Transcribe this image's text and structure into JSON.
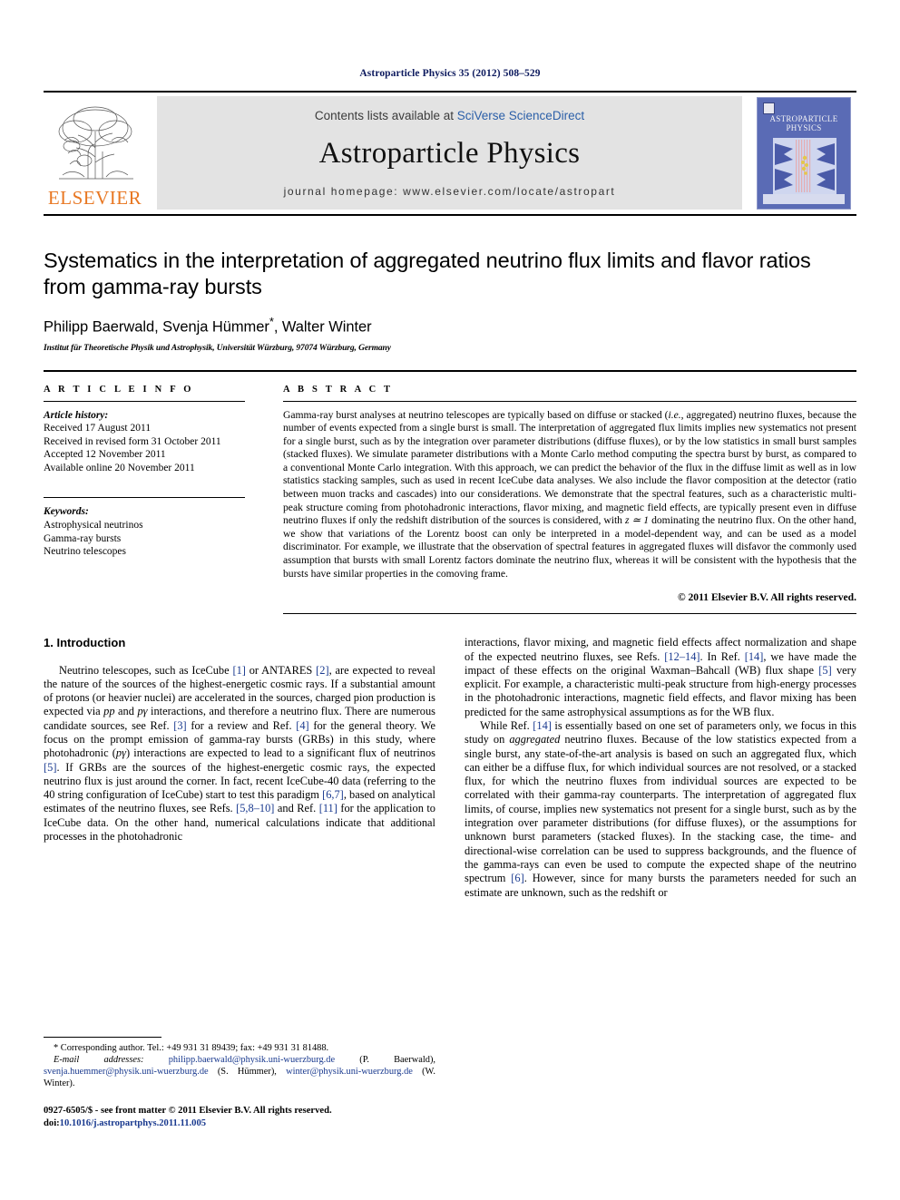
{
  "running_head": "Astroparticle Physics 35 (2012) 508–529",
  "masthead": {
    "contents_prefix": "Contents lists available at ",
    "contents_link": "SciVerse ScienceDirect",
    "journal_title": "Astroparticle Physics",
    "homepage": "journal homepage: www.elsevier.com/locate/astropart",
    "publisher_wordmark": "ELSEVIER",
    "cover_title_line1": "ASTROPARTICLE",
    "cover_title_line2": "PHYSICS"
  },
  "article": {
    "title": "Systematics in the interpretation of aggregated neutrino flux limits and flavor ratios from gamma-ray bursts",
    "authors": "Philipp Baerwald, Svenja Hümmer",
    "authors_suffix": ", Walter Winter",
    "corresponding_marker": "*",
    "affiliation": "Institut für Theoretische Physik und Astrophysik, Universität Würzburg, 97074 Würzburg, Germany"
  },
  "article_info": {
    "heading": "A R T I C L E   I N F O",
    "history_label": "Article history:",
    "history": [
      "Received 17 August 2011",
      "Received in revised form 31 October 2011",
      "Accepted 12 November 2011",
      "Available online 20 November 2011"
    ],
    "keywords_label": "Keywords:",
    "keywords": [
      "Astrophysical neutrinos",
      "Gamma-ray bursts",
      "Neutrino telescopes"
    ]
  },
  "abstract": {
    "heading": "A B S T R A C T",
    "part1": "Gamma-ray burst analyses at neutrino telescopes are typically based on diffuse or stacked (",
    "italic1": "i.e.",
    "part2": ", aggregated) neutrino fluxes, because the number of events expected from a single burst is small. The interpretation of aggregated flux limits implies new systematics not present for a single burst, such as by the integration over parameter distributions (diffuse fluxes), or by the low statistics in small burst samples (stacked fluxes). We simulate parameter distributions with a Monte Carlo method computing the spectra burst by burst, as compared to a conventional Monte Carlo integration. With this approach, we can predict the behavior of the flux in the diffuse limit as well as in low statistics stacking samples, such as used in recent IceCube data analyses. We also include the flavor composition at the detector (ratio between muon tracks and cascades) into our considerations. We demonstrate that the spectral features, such as a characteristic multi-peak structure coming from photohadronic interactions, flavor mixing, and magnetic field effects, are typically present even in diffuse neutrino fluxes if only the redshift distribution of the sources is considered, with ",
    "italic2": "z ≃ 1",
    "part3": " dominating the neutrino flux. On the other hand, we show that variations of the Lorentz boost can only be interpreted in a model-dependent way, and can be used as a model discriminator. For example, we illustrate that the observation of spectral features in aggregated fluxes will disfavor the commonly used assumption that bursts with small Lorentz factors dominate the neutrino flux, whereas it will be consistent with the hypothesis that the bursts have similar properties in the comoving frame.",
    "copyright": "© 2011 Elsevier B.V. All rights reserved."
  },
  "body": {
    "section_heading": "1. Introduction",
    "left_p1_a": "Neutrino telescopes, such as IceCube ",
    "left_ref1": "[1]",
    "left_p1_b": " or ANTARES ",
    "left_ref2": "[2]",
    "left_p1_c": ", are expected to reveal the nature of the sources of the highest-energetic cosmic rays. If a substantial amount of protons (or heavier nuclei) are accelerated in the sources, charged pion production is expected via ",
    "left_it1": "pp",
    "left_p1_d": " and ",
    "left_it2": "pγ",
    "left_p1_e": " interactions, and therefore a neutrino flux. There are numerous candidate sources, see Ref. ",
    "left_ref3": "[3]",
    "left_p1_f": " for a review and Ref. ",
    "left_ref4": "[4]",
    "left_p1_g": " for the general theory. We focus on the prompt emission of gamma-ray bursts (GRBs) in this study, where photohadronic (",
    "left_it3": "pγ",
    "left_p1_h": ") interactions are expected to lead to a significant flux of neutrinos ",
    "left_ref5": "[5]",
    "left_p1_i": ". If GRBs are the sources of the highest-energetic cosmic rays, the expected neutrino flux is just around the corner. In fact, recent IceCube-40 data (referring to the 40 string configuration of IceCube) start to test this paradigm ",
    "left_ref6": "[6,7]",
    "left_p1_j": ", based on analytical estimates of the neutrino fluxes, see Refs. ",
    "left_ref7": "[5,8–10]",
    "left_p1_k": " and Ref. ",
    "left_ref8": "[11]",
    "left_p1_l": " for the application to IceCube data. On the other hand, numerical calculations indicate that additional processes in the photohadronic",
    "right_p1_a": "interactions, flavor mixing, and magnetic field effects affect normalization and shape of the expected neutrino fluxes, see Refs. ",
    "right_ref1": "[12–14]",
    "right_p1_b": ". In Ref. ",
    "right_ref2": "[14]",
    "right_p1_c": ", we have made the impact of these effects on the original Waxman–Bahcall (WB) flux shape ",
    "right_ref3": "[5]",
    "right_p1_d": " very explicit. For example, a characteristic multi-peak structure from high-energy processes in the photohadronic interactions, magnetic field effects, and flavor mixing has been predicted for the same astrophysical assumptions as for the WB flux.",
    "right_p2_a": "While Ref. ",
    "right_ref4": "[14]",
    "right_p2_b": " is essentially based on one set of parameters only, we focus in this study on ",
    "right_it1": "aggregated",
    "right_p2_c": " neutrino fluxes. Because of the low statistics expected from a single burst, any state-of-the-art analysis is based on such an aggregated flux, which can either be a diffuse flux, for which individual sources are not resolved, or a stacked flux, for which the neutrino fluxes from individual sources are expected to be correlated with their gamma-ray counterparts. The interpretation of aggregated flux limits, of course, implies new systematics not present for a single burst, such as by the integration over parameter distributions (for diffuse fluxes), or the assumptions for unknown burst parameters (stacked fluxes). In the stacking case, the time- and directional-wise correlation can be used to suppress backgrounds, and the fluence of the gamma-rays can even be used to compute the expected shape of the neutrino spectrum ",
    "right_ref5": "[6]",
    "right_p2_d": ". However, since for many bursts the parameters needed for such an estimate are unknown, such as the redshift or"
  },
  "footnotes": {
    "corresponding": "* Corresponding author. Tel.: +49 931 31 89439; fax: +49 931 31 81488.",
    "email_label": "E-mail addresses:",
    "email1": "philipp.baerwald@physik.uni-wuerzburg.de",
    "email1_name": " (P. Baerwald), ",
    "email2": "svenja.huemmer@physik.uni-wuerzburg.de",
    "email2_name": " (S. Hümmer), ",
    "email3": "winter@physik.uni-wuerzburg.de",
    "email3_name": " (W. Winter).",
    "issn_line": "0927-6505/$ - see front matter © 2011 Elsevier B.V. All rights reserved.",
    "doi_label": "doi:",
    "doi_value": "10.1016/j.astropartphys.2011.11.005"
  },
  "colors": {
    "running_head": "#0d1a5e",
    "link": "#2b5fa8",
    "reference": "#1a3a8f",
    "elsevier_orange": "#E87722",
    "masthead_bg": "#e3e3e3",
    "cover_blue": "#5a6bb5"
  }
}
